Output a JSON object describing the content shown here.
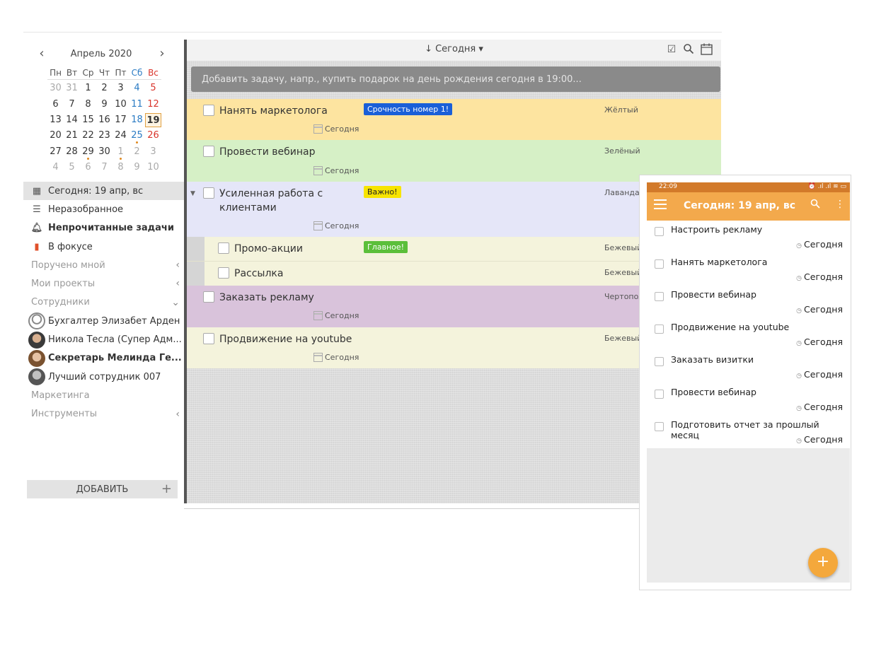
{
  "calendar": {
    "month": "Апрель 2020",
    "prev_icon": "‹",
    "next_icon": "›",
    "weekdays": [
      "Пн",
      "Вт",
      "Ср",
      "Чт",
      "Пт",
      "Сб",
      "Вс"
    ],
    "weeks": [
      [
        "30",
        "31",
        "1",
        "2",
        "3",
        "4",
        "5"
      ],
      [
        "6",
        "7",
        "8",
        "9",
        "10",
        "11",
        "12"
      ],
      [
        "13",
        "14",
        "15",
        "16",
        "17",
        "18",
        "19"
      ],
      [
        "20",
        "21",
        "22",
        "23",
        "24",
        "25",
        "26"
      ],
      [
        "27",
        "28",
        "29",
        "30",
        "1",
        "2",
        "3"
      ],
      [
        "4",
        "5",
        "6",
        "7",
        "8",
        "9",
        "10"
      ]
    ]
  },
  "sidebar": {
    "items": [
      {
        "label": "Сегодня: 19 апр, вс",
        "icon": "calendar-icon"
      },
      {
        "label": "Неразобранное",
        "icon": "inbox-icon"
      },
      {
        "label": "Непрочитанные задачи",
        "icon": "bell-icon"
      },
      {
        "label": "В фокусе",
        "icon": "bookmark-icon"
      },
      {
        "label": "Поручено мной"
      },
      {
        "label": "Мои проекты"
      },
      {
        "label": "Сотрудники"
      },
      {
        "label": "Бухгалтер Элизабет Арден"
      },
      {
        "label": "Никола Тесла (Супер Адм..."
      },
      {
        "label": "Секретарь Мелинда Ге..."
      },
      {
        "label": "Лучший сотрудник 007"
      },
      {
        "label": "Маркетинга"
      },
      {
        "label": "Инструменты"
      }
    ],
    "add_label": "ДОБАВИТЬ",
    "add_icon": "+"
  },
  "toolbar": {
    "sort_label": "↓ Сегодня ▾",
    "icons": [
      "checkbox-icon",
      "search-icon",
      "calendar-icon"
    ]
  },
  "add_task": {
    "placeholder": "Добавить задачу, напр., купить подарок на день рождения сегодня в 19:00..."
  },
  "tasks": [
    {
      "title": "Нанять маркетолога",
      "tag": "Срочность номер 1!",
      "tag_color": "#1a5fd8",
      "color_label": "Жёлтый",
      "due": "Сегодня",
      "bg": "#fde4a0"
    },
    {
      "title": "Провести вебинар",
      "tag": "",
      "color_label": "Зелёный",
      "due": "Сегодня",
      "bg": "#d6f0c6"
    },
    {
      "title": "Усиленная работа с клиентами",
      "tag": "Важно!",
      "tag_color": "#f7e400",
      "color_label": "Лаванда",
      "due": "Сегодня",
      "bg": "#e5e6f8"
    },
    {
      "title": "Промо-акции",
      "tag": "Главное!",
      "tag_color": "#5bbf3a",
      "color_label": "Бежевый",
      "due": "",
      "bg": "#f4f3dc"
    },
    {
      "title": "Рассылка",
      "tag": "",
      "color_label": "Бежевый",
      "due": "",
      "bg": "#f4f3dc"
    },
    {
      "title": "Заказать рекламу",
      "tag": "",
      "color_label": "Чертопол...",
      "due": "Сегодня",
      "bg": "#d9c3db"
    },
    {
      "title": "Продвижение на youtube",
      "tag": "",
      "color_label": "Бежевый",
      "due": "Сегодня",
      "bg": "#f4f3dc"
    }
  ],
  "mobile": {
    "time": "22:09",
    "status_icons": "⏰ .ıl .ıl ≋ ▭",
    "title": "Сегодня: 19 апр, вс",
    "menu_icon": "menu-icon",
    "search_icon": "search-icon",
    "more_icon": "more-vert-icon",
    "fab": "+",
    "tasks": [
      {
        "title": "Настроить рекламу",
        "due": "Сегодня"
      },
      {
        "title": "Нанять маркетолога",
        "due": "Сегодня"
      },
      {
        "title": "Провести вебинар",
        "due": "Сегодня"
      },
      {
        "title": "Продвижение на youtube",
        "due": "Сегодня"
      },
      {
        "title": "Заказать визитки",
        "due": "Сегодня"
      },
      {
        "title": "Провести вебинар",
        "due": "Сегодня"
      },
      {
        "title": "Подготовить отчет за прошлый месяц",
        "due": "Сегодня"
      }
    ]
  }
}
